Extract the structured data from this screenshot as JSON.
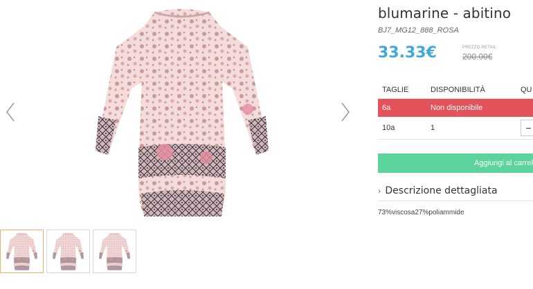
{
  "gallery": {
    "prev_icon": "chevron-left-icon",
    "next_icon": "chevron-right-icon",
    "main_image": "lace-print-dress-image",
    "thumbnails": [
      "thumbnail-1",
      "thumbnail-2",
      "thumbnail-3"
    ],
    "active_thumbnail": 0
  },
  "product": {
    "title": "blumarine - abitino",
    "sku": "BJ7_MG12_888_ROSA",
    "price": "33.33€",
    "retail_label": "PREZZO RETAIL",
    "retail_price": "200.00€"
  },
  "sizes": {
    "headers": [
      "TAGLIE",
      "DISPONIBILITÀ",
      "QU"
    ],
    "rows": [
      {
        "size": "6a",
        "availability": "Non disponibile"
      },
      {
        "size": "10a",
        "availability": "1",
        "qty_control": "−"
      }
    ]
  },
  "cart": {
    "add_label": "Aggiungi al carrel"
  },
  "description": {
    "toggle_icon": "›",
    "toggle_label": "Descrizione dettagliata",
    "composition": "73%viscosa27%poliammide"
  },
  "colors": {
    "price": "#3fa9d9",
    "unavailable": "#e4535a",
    "add_to_cart": "#5bd39a",
    "active_thumb_border": "#f0b26a"
  }
}
